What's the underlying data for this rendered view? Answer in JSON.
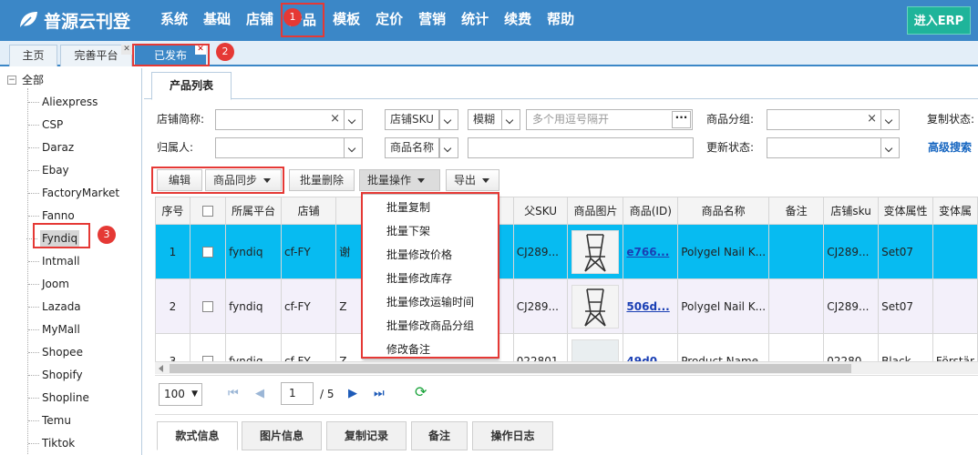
{
  "app": {
    "title": "普源云刊登",
    "erp_button": "进入ERP"
  },
  "nav": [
    "系统",
    "基础",
    "店铺",
    "产品",
    "模板",
    "定价",
    "营销",
    "统计",
    "续费",
    "帮助"
  ],
  "page_tabs": {
    "home": "主页",
    "improve": "完善平台",
    "published": "已发布"
  },
  "badges": [
    "1",
    "2",
    "3"
  ],
  "tree": {
    "root": "全部",
    "items": [
      "Aliexpress",
      "CSP",
      "Daraz",
      "Ebay",
      "FactoryMarket",
      "Fanno",
      "Fyndiq",
      "Intmall",
      "Joom",
      "Lazada",
      "MyMall",
      "Shopee",
      "Shopify",
      "Shopline",
      "Temu",
      "Tiktok"
    ],
    "selected": "Fyndiq"
  },
  "subtab": "产品列表",
  "filters": {
    "shop_short_label": "店铺简称:",
    "owner_label": "归属人:",
    "shop_sku_select": "店铺SKU",
    "match_select": "模糊",
    "multi_placeholder": "多个用逗号隔开",
    "product_name_select": "商品名称",
    "product_group_label": "商品分组:",
    "update_status_label": "更新状态:",
    "copy_status_label": "复制状态:",
    "advanced_search": "高级搜索"
  },
  "toolbar": {
    "edit": "编辑",
    "sync": "商品同步",
    "bulk_delete": "批量删除",
    "bulk_ops": "批量操作",
    "export": "导出"
  },
  "bulk_menu": [
    "批量复制",
    "批量下架",
    "批量修改价格",
    "批量修改库存",
    "批量修改运输时间",
    "批量修改商品分组",
    "修改备注"
  ],
  "table": {
    "headers": [
      "序号",
      "",
      "所属平台",
      "店铺",
      "",
      "父SKU",
      "商品图片",
      "商品(ID)",
      "商品名称",
      "备注",
      "店铺sku",
      "变体属性",
      "变体属"
    ],
    "rows": [
      {
        "no": "1",
        "platform": "fyndiq",
        "shop": "cf-FY",
        "col5": "谢",
        "parent_sku": "CJ289...",
        "id": "e766...",
        "name": "Polygel Nail K...",
        "note": "",
        "shop_sku": "CJ289...",
        "variant": "Set07",
        "variant2": ""
      },
      {
        "no": "2",
        "platform": "fyndiq",
        "shop": "cf-FY",
        "col5": "Z",
        "parent_sku": "CJ289...",
        "id": "506d...",
        "name": "Polygel Nail K...",
        "note": "",
        "shop_sku": "CJ289...",
        "variant": "Set07",
        "variant2": ""
      },
      {
        "no": "3",
        "platform": "fyndiq",
        "shop": "cf-FY",
        "col5": "Z",
        "parent_sku": "022801",
        "id": "49d0...",
        "name": "Product Name",
        "note": "",
        "shop_sku": "02280...",
        "variant": "Black ...",
        "variant2": "Förstär"
      }
    ]
  },
  "pager": {
    "page_size": "100",
    "page": "1",
    "total_text": "/ 5"
  },
  "bottom_tabs": [
    "款式信息",
    "图片信息",
    "复制记录",
    "备注",
    "操作日志"
  ],
  "colors": {
    "header": "#3b87c7",
    "erp": "#1fb49a",
    "selected_row": "#07bbf1",
    "highlight": "#e53935"
  }
}
